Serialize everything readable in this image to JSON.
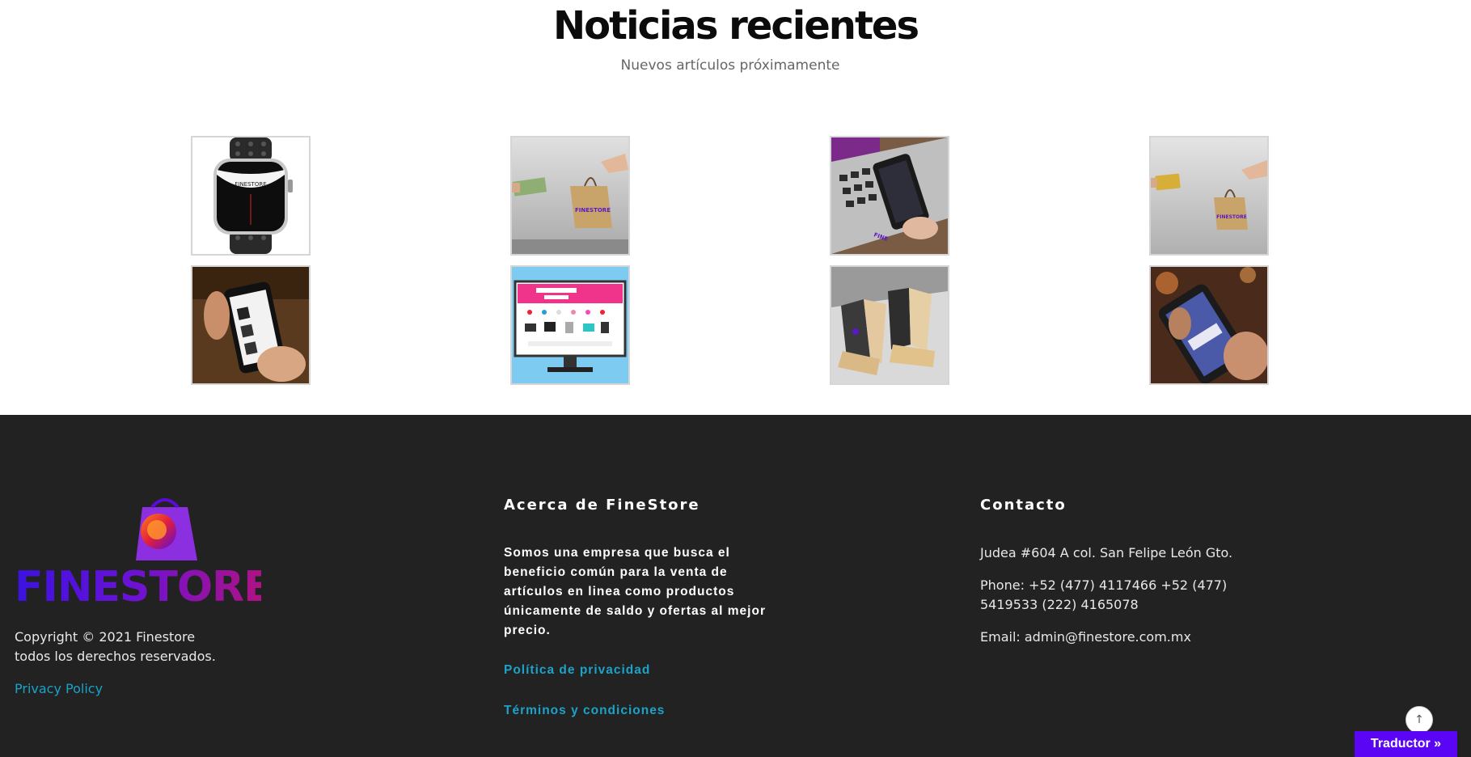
{
  "news": {
    "title": "Noticias recientes",
    "subtitle": "Nuevos artículos próximamente"
  },
  "gallery": {
    "items": [
      {
        "icon": "smartwatch-image"
      },
      {
        "icon": "cash-shopping-bag-image"
      },
      {
        "icon": "laptop-phone-image"
      },
      {
        "icon": "card-shopping-bag-image"
      },
      {
        "icon": "phone-shopping-image"
      },
      {
        "icon": "online-store-monitor-image"
      },
      {
        "icon": "shopping-bags-image"
      },
      {
        "icon": "mobile-app-image"
      }
    ]
  },
  "footer": {
    "logo_text": "FINESTORE",
    "copyright_line1": "Copyright © 2021 Finestore",
    "copyright_line2": "todos los derechos reservados.",
    "privacy_link": "Privacy Policy",
    "about_heading": "Acerca de FineStore",
    "about_text": "Somos una empresa que busca el beneficio común para la venta de artículos en linea como productos únicamente de saldo y ofertas al mejor precio.",
    "privacy_es": "Política de privacidad",
    "terms": "Términos y condiciones",
    "contact_heading": "Contacto",
    "address": "Judea #604 A col. San Felipe León Gto.",
    "phone": "Phone: +52 (477) 4117466 +52 (477) 5419533 (222) 4165078",
    "email": "Email: admin@finestore.com.mx"
  },
  "widgets": {
    "scroll_top_icon": "↑",
    "translator": "Traductor »"
  },
  "colors": {
    "footer_bg": "#222222",
    "link": "#19a3c9",
    "translator_bg": "#5a06f5"
  }
}
